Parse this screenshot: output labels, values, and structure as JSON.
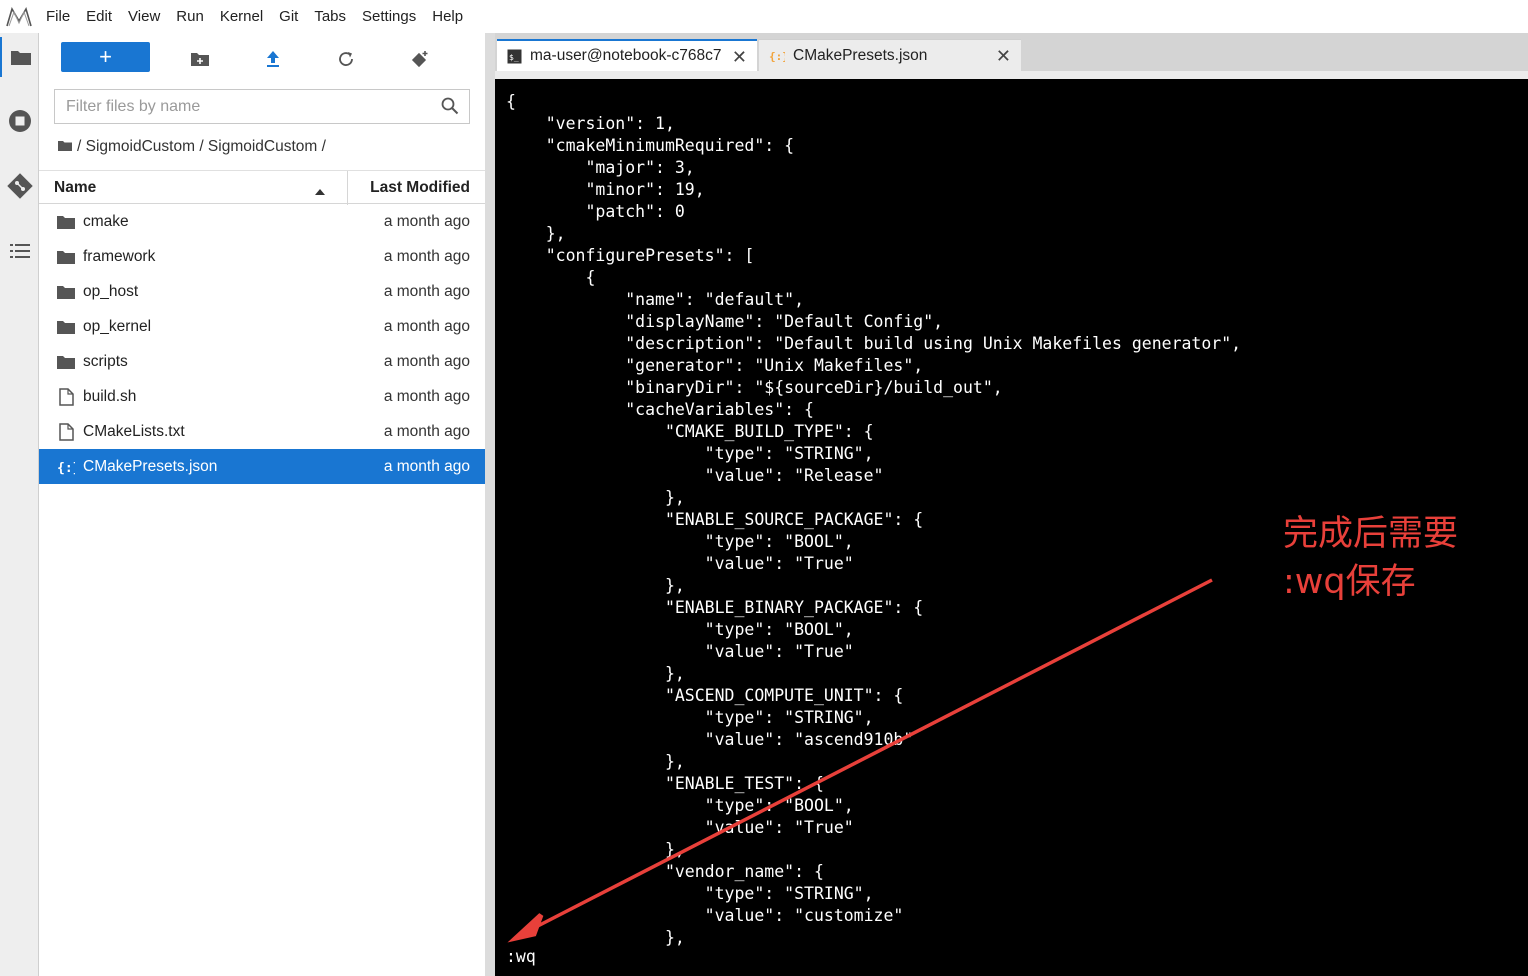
{
  "menu": [
    "File",
    "Edit",
    "View",
    "Run",
    "Kernel",
    "Git",
    "Tabs",
    "Settings",
    "Help"
  ],
  "toolbar": {
    "new_label": "+"
  },
  "filter": {
    "placeholder": "Filter files by name"
  },
  "breadcrumb": {
    "path": "/ SigmoidCustom / SigmoidCustom /"
  },
  "columns": {
    "name": "Name",
    "modified": "Last Modified"
  },
  "files": [
    {
      "name": "cmake",
      "modified": "a month ago",
      "kind": "folder",
      "icon": "folder-icon"
    },
    {
      "name": "framework",
      "modified": "a month ago",
      "kind": "folder",
      "icon": "folder-icon"
    },
    {
      "name": "op_host",
      "modified": "a month ago",
      "kind": "folder",
      "icon": "folder-icon"
    },
    {
      "name": "op_kernel",
      "modified": "a month ago",
      "kind": "folder",
      "icon": "folder-icon"
    },
    {
      "name": "scripts",
      "modified": "a month ago",
      "kind": "folder",
      "icon": "folder-icon"
    },
    {
      "name": "build.sh",
      "modified": "a month ago",
      "kind": "file",
      "icon": "file-icon"
    },
    {
      "name": "CMakeLists.txt",
      "modified": "a month ago",
      "kind": "file",
      "icon": "file-icon"
    },
    {
      "name": "CMakePresets.json",
      "modified": "a month ago",
      "kind": "json",
      "icon": "json-icon",
      "selected": true
    }
  ],
  "tabs": [
    {
      "label": "ma-user@notebook-c768c7",
      "close": "✕",
      "icon": "terminal-icon",
      "active": true
    },
    {
      "label": "CMakePresets.json",
      "close": "✕",
      "icon": "json-icon",
      "active": false
    }
  ],
  "terminal": {
    "lines": [
      "{",
      "    \"version\": 1,",
      "    \"cmakeMinimumRequired\": {",
      "        \"major\": 3,",
      "        \"minor\": 19,",
      "        \"patch\": 0",
      "    },",
      "    \"configurePresets\": [",
      "        {",
      "            \"name\": \"default\",",
      "            \"displayName\": \"Default Config\",",
      "            \"description\": \"Default build using Unix Makefiles generator\",",
      "            \"generator\": \"Unix Makefiles\",",
      "            \"binaryDir\": \"${sourceDir}/build_out\",",
      "            \"cacheVariables\": {",
      "                \"CMAKE_BUILD_TYPE\": {",
      "                    \"type\": \"STRING\",",
      "                    \"value\": \"Release\"",
      "                },",
      "                \"ENABLE_SOURCE_PACKAGE\": {",
      "                    \"type\": \"BOOL\",",
      "                    \"value\": \"True\"",
      "                },",
      "                \"ENABLE_BINARY_PACKAGE\": {",
      "                    \"type\": \"BOOL\",",
      "                    \"value\": \"True\"",
      "                },",
      "                \"ASCEND_COMPUTE_UNIT\": {",
      "                    \"type\": \"STRING\",",
      "                    \"value\": \"ascend910b\"",
      "                },",
      "                \"ENABLE_TEST\": {",
      "                    \"type\": \"BOOL\",",
      "                    \"value\": \"True\"",
      "                },",
      "                \"vendor_name\": {",
      "                    \"type\": \"STRING\",",
      "                    \"value\": \"customize\"",
      "                },"
    ],
    "command": ":wq"
  },
  "annotation": {
    "line1": "完成后需要",
    "line2": ":wq保存",
    "color": "#e8403a"
  },
  "colors": {
    "accent": "#1976d2",
    "terminal_bg": "#000000"
  }
}
